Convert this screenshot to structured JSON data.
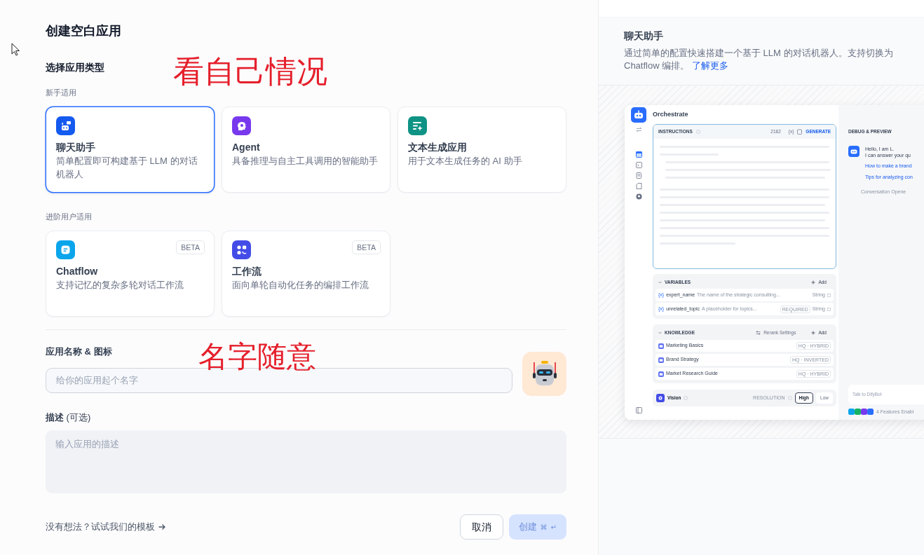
{
  "page_title": "创建空白应用",
  "app_type": {
    "heading": "选择应用类型",
    "groups": [
      {
        "label": "新手适用",
        "items": [
          {
            "kind": "chatbot",
            "title": "聊天助手",
            "description": "简单配置即可构建基于 LLM 的对话机器人",
            "color": "#155aef",
            "selected": true
          },
          {
            "kind": "agent",
            "title": "Agent",
            "description": "具备推理与自主工具调用的智能助手",
            "color": "#7839ee",
            "selected": false
          },
          {
            "kind": "completion",
            "title": "文本生成应用",
            "description": "用于文本生成任务的 AI 助手",
            "color": "#0e9384",
            "selected": false
          }
        ]
      },
      {
        "label": "进阶用户适用",
        "items": [
          {
            "kind": "chatflow",
            "title": "Chatflow",
            "description": "支持记忆的复杂多轮对话工作流",
            "color": "#0ba5ec",
            "badge": "BETA",
            "selected": false
          },
          {
            "kind": "workflow",
            "title": "工作流",
            "description": "面向单轮自动化任务的编排工作流",
            "color": "#444ce7",
            "badge": "BETA",
            "selected": false
          }
        ]
      }
    ]
  },
  "name_field": {
    "label": "应用名称 & 图标",
    "placeholder": "给你的应用起个名字"
  },
  "description_field": {
    "label": "**描述** (可选)",
    "placeholder": "输入应用的描述"
  },
  "template_link": "没有想法？试试我们的模板",
  "buttons": [
    {
      "kind": "cancel",
      "label": "取消"
    },
    {
      "kind": "create",
      "label": "创建",
      "shortcut": [
        "⌘",
        "↵"
      ],
      "disabled": true
    }
  ],
  "annotations": [
    {
      "text": "看自己情况"
    },
    {
      "text": "名字随意"
    }
  ],
  "info": {
    "title": "聊天助手",
    "description": "通过简单的配置快速搭建一个基于 LLM 的对话机器人。支持切换为 Chatflow 编排。",
    "link": "了解更多"
  },
  "preview": {
    "title": "Orchestrate",
    "instructions": {
      "label": "INSTRUCTIONS",
      "count": "2182",
      "token": "{x}",
      "generate": "GENERATE"
    },
    "variables": {
      "label": "VARIABLES",
      "add": "Add",
      "items": [
        {
          "token": "{x}",
          "name": "expert_name",
          "description": "The name of the strategic consulting...",
          "type": "String"
        },
        {
          "token": "{x}",
          "name": "unrelated_topic",
          "description": "A placeholder for topics...",
          "required": "REQUIRED",
          "type": "String"
        }
      ]
    },
    "knowledge": {
      "label": "KNOWLEDGE",
      "rerank": "Rerank Settings",
      "add": "Add",
      "items": [
        {
          "name": "Marketing Basics",
          "tag": "HQ · HYBRID"
        },
        {
          "name": "Brand Strategy",
          "tag": "HQ · INVERTED"
        },
        {
          "name": "Market Research Guide",
          "tag": "HQ · HYBRID"
        }
      ]
    },
    "vision": {
      "label": "Vision",
      "resolution_label": "RESOLUTION",
      "options": [
        {
          "label": "High",
          "selected": true
        },
        {
          "label": "Low",
          "selected": false
        }
      ]
    },
    "debug": {
      "label": "DEBUG & PREVIEW",
      "greeting": [
        "Hello, I am L.",
        "I can answer your qu"
      ],
      "suggestions": [
        "How to make a brand",
        "Tips for analyzing con"
      ],
      "opener": "Conversation Opene",
      "input_placeholder": "Talk to DifyBot",
      "features": "4 Features Enabl"
    }
  }
}
